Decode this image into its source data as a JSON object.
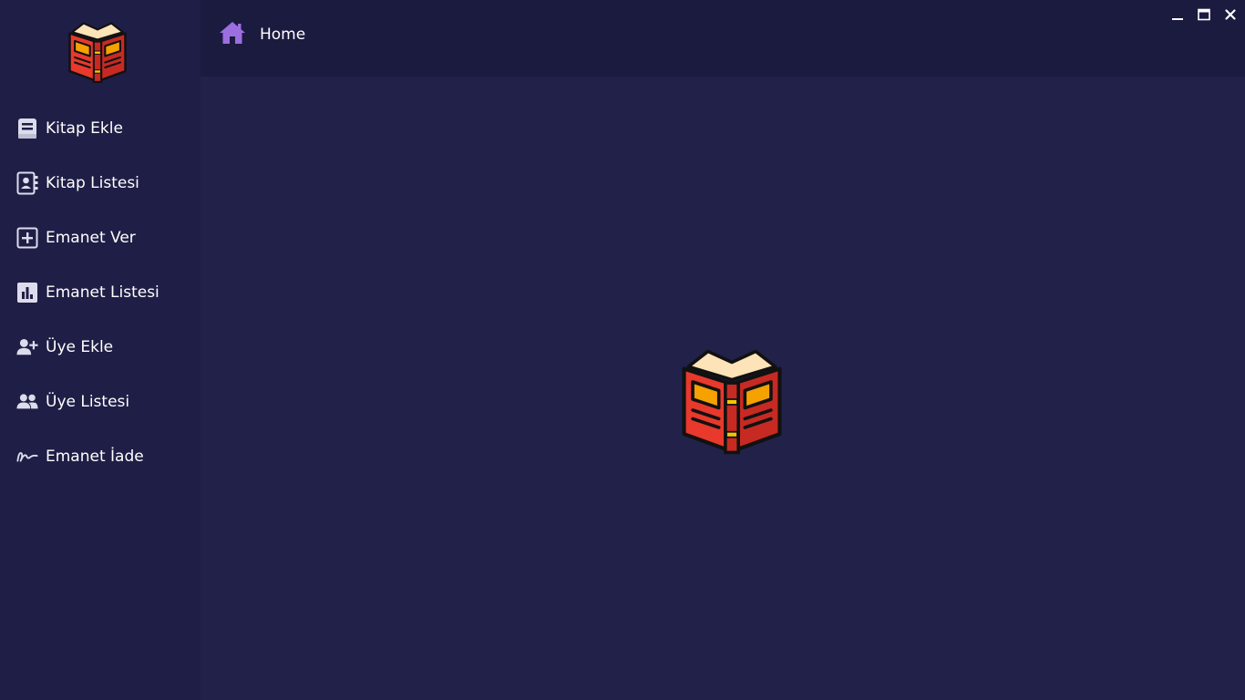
{
  "header": {
    "title": "Home"
  },
  "sidebar": {
    "items": [
      {
        "label": "Kitap Ekle",
        "icon": "book-icon"
      },
      {
        "label": "Kitap Listesi",
        "icon": "contact-book-icon"
      },
      {
        "label": "Emanet Ver",
        "icon": "plus-square-icon"
      },
      {
        "label": "Emanet Listesi",
        "icon": "bar-chart-icon"
      },
      {
        "label": "Üye Ekle",
        "icon": "user-plus-icon"
      },
      {
        "label": "Üye Listesi",
        "icon": "users-icon"
      },
      {
        "label": "Emanet İade",
        "icon": "signature-icon"
      }
    ]
  },
  "window_controls": [
    "minimize-icon",
    "maximize-icon",
    "close-icon"
  ],
  "colors": {
    "sidebar_bg": "#1f1e46",
    "topbar_bg": "#1b1a3f",
    "content_bg": "#22214a",
    "home_icon": "#9b6fe0",
    "book_red": "#e8392c",
    "book_orange": "#f5a100",
    "book_pages": "#fde3b8"
  }
}
